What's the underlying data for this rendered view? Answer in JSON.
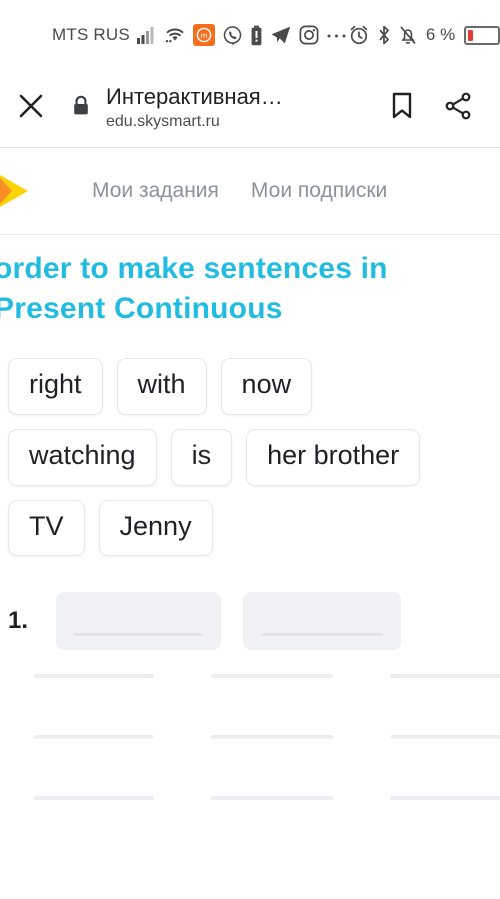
{
  "status_bar": {
    "carrier": "MTS RUS",
    "icons_left": [
      "signal-bars-icon",
      "wifi-icon",
      "app-notification-badge-icon",
      "viber-icon",
      "battery-alert-icon",
      "telegram-icon",
      "instagram-icon",
      "more-dots-icon"
    ],
    "icons_right": [
      "alarm-clock-icon",
      "bluetooth-icon",
      "notifications-off-icon"
    ],
    "battery_percent": "6 %",
    "badge_color": "#f4701f",
    "battery_low_color": "#e53935"
  },
  "toolbar": {
    "close_label": "close-icon",
    "lock_label": "lock-icon",
    "title": "Интерактивная…",
    "url": "edu.skysmart.ru",
    "bookmark_label": "bookmark-icon",
    "share_label": "share-icon"
  },
  "site_header": {
    "logo_name": "skysmart-logo",
    "logo_colors": {
      "blue": "#29b6e8",
      "yellow": "#fcd307",
      "orange": "#f8892a"
    },
    "nav": [
      {
        "label": "Мои задания"
      },
      {
        "label": "Мои подписки"
      }
    ]
  },
  "task": {
    "title_color": "#23bce1",
    "title_lines": [
      "order to make sentences in",
      "Present Continuous"
    ],
    "word_chips": [
      [
        "right",
        "with",
        "now"
      ],
      [
        "watching",
        "is",
        "her brother"
      ],
      [
        "TV",
        "Jenny"
      ]
    ],
    "answer_rows": [
      {
        "number": "1.",
        "slots": 2
      }
    ],
    "blank_line_rows": 3
  }
}
